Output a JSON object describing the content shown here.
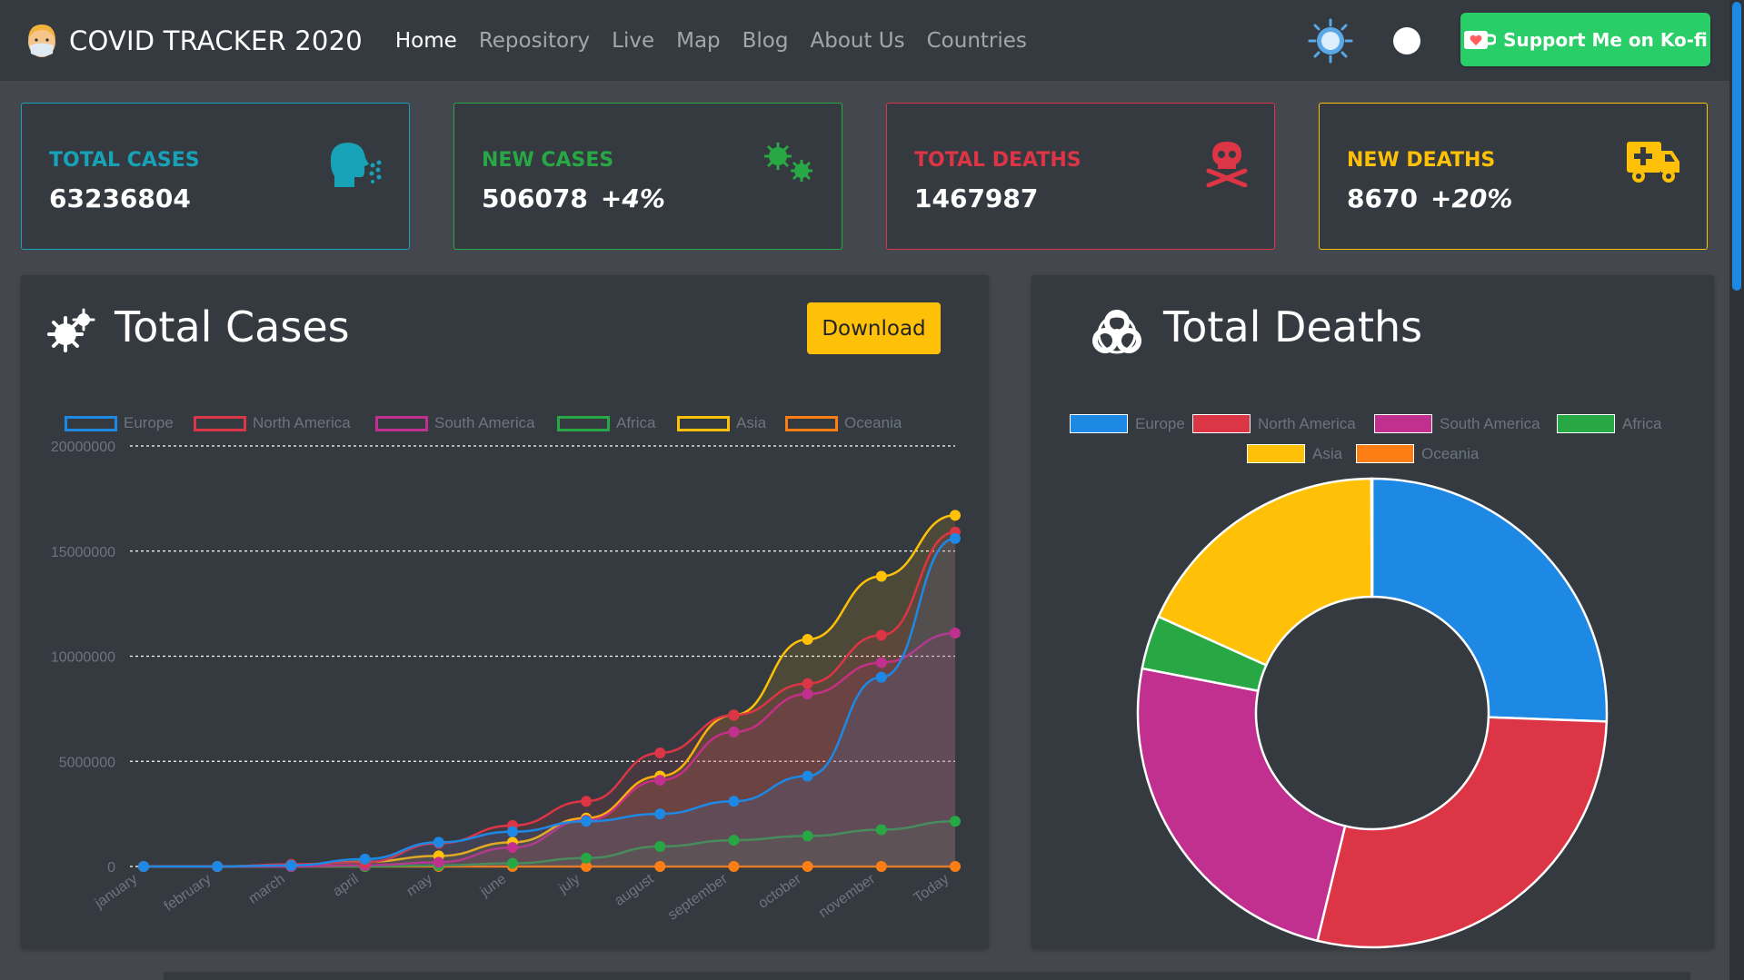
{
  "navbar": {
    "brand": "COVID TRACKER 2020",
    "links": [
      "Home",
      "Repository",
      "Live",
      "Map",
      "Blog",
      "About Us",
      "Countries"
    ],
    "active": "Home",
    "kofi_label": "Support Me on Ko-fi"
  },
  "stats": [
    {
      "title": "TOTAL CASES",
      "value": "63236804",
      "change": "",
      "color": "#17a2b8",
      "icon": "cough-icon"
    },
    {
      "title": "NEW CASES",
      "value": "506078",
      "change": "+4%",
      "color": "#28a745",
      "icon": "virus-icon"
    },
    {
      "title": "TOTAL DEATHS",
      "value": "1467987",
      "change": "",
      "color": "#dc3545",
      "icon": "skull-crossbones-icon"
    },
    {
      "title": "NEW DEATHS",
      "value": "8670",
      "change": "+20%",
      "color": "#ffc107",
      "icon": "ambulance-icon"
    }
  ],
  "cases_panel": {
    "title": "Total Cases",
    "download_label": "Download"
  },
  "deaths_panel": {
    "title": "Total Deaths"
  },
  "chart_data": [
    {
      "type": "line",
      "categories": [
        "january",
        "february",
        "march",
        "april",
        "may",
        "june",
        "july",
        "august",
        "september",
        "october",
        "november",
        "Today"
      ],
      "ylim": [
        0,
        20000000
      ],
      "yticks": [
        "0",
        "5000000",
        "10000000",
        "15000000",
        "20000000"
      ],
      "grid": true,
      "legend_position": "top",
      "series": [
        {
          "name": "Europe",
          "color": "#1e88e5",
          "values": [
            0,
            0,
            50000,
            350000,
            1150000,
            1650000,
            2150000,
            2500000,
            3100000,
            4300000,
            9000000,
            15600000
          ]
        },
        {
          "name": "North America",
          "color": "#dc3545",
          "values": [
            0,
            0,
            100000,
            200000,
            1100000,
            1950000,
            3100000,
            5400000,
            7200000,
            8700000,
            11000000,
            15900000
          ]
        },
        {
          "name": "South America",
          "color": "#c2308f",
          "values": [
            0,
            0,
            0,
            50000,
            200000,
            900000,
            2200000,
            4100000,
            6400000,
            8200000,
            9700000,
            11100000
          ]
        },
        {
          "name": "Africa",
          "color": "#28a745",
          "values": [
            0,
            0,
            0,
            0,
            50000,
            150000,
            400000,
            950000,
            1250000,
            1450000,
            1750000,
            2150000
          ]
        },
        {
          "name": "Asia",
          "color": "#ffc107",
          "values": [
            0,
            0,
            80000,
            220000,
            500000,
            1150000,
            2300000,
            4300000,
            7200000,
            10800000,
            13800000,
            16700000
          ]
        },
        {
          "name": "Oceania",
          "color": "#fd7e14",
          "values": [
            0,
            0,
            0,
            0,
            0,
            0,
            0,
            0,
            0,
            0,
            0,
            0
          ]
        }
      ]
    },
    {
      "type": "pie",
      "labels": [
        "Europe",
        "North America",
        "South America",
        "Africa",
        "Asia",
        "Oceania"
      ],
      "colors": [
        "#1e88e5",
        "#dc3545",
        "#c2308f",
        "#28a745",
        "#ffc107",
        "#fd7e14"
      ],
      "values": [
        25.6,
        28.2,
        24.3,
        3.7,
        18.2,
        0.07
      ],
      "legend_position": "top",
      "doughnut": true
    }
  ]
}
